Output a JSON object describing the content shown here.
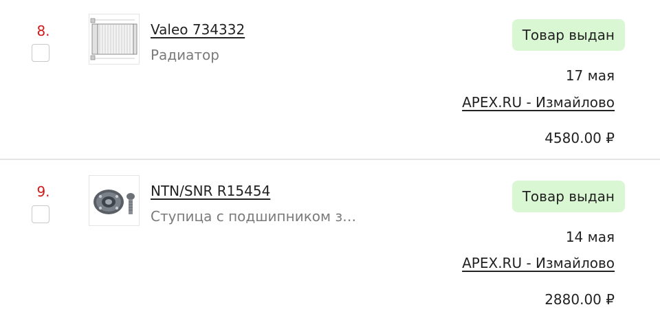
{
  "orders": [
    {
      "number": "8.",
      "title": "Valeo 734332",
      "description": "Радиатор",
      "status": "Товар выдан",
      "date": "17 мая",
      "store": "APEX.RU - Измайлово",
      "price": "4580.00 ₽",
      "image": "radiator-image"
    },
    {
      "number": "9.",
      "title": "NTN/SNR R15454",
      "description": "Ступица с подшипником з…",
      "status": "Товар выдан",
      "date": "14 мая",
      "store": "APEX.RU - Измайлово",
      "price": "2880.00 ₽",
      "image": "wheel-hub-image"
    }
  ],
  "colors": {
    "order_number": "#d01a1a",
    "status_background": "#d9f7d3",
    "description_text": "#7a7a7a",
    "divider": "#e6e6e6"
  }
}
